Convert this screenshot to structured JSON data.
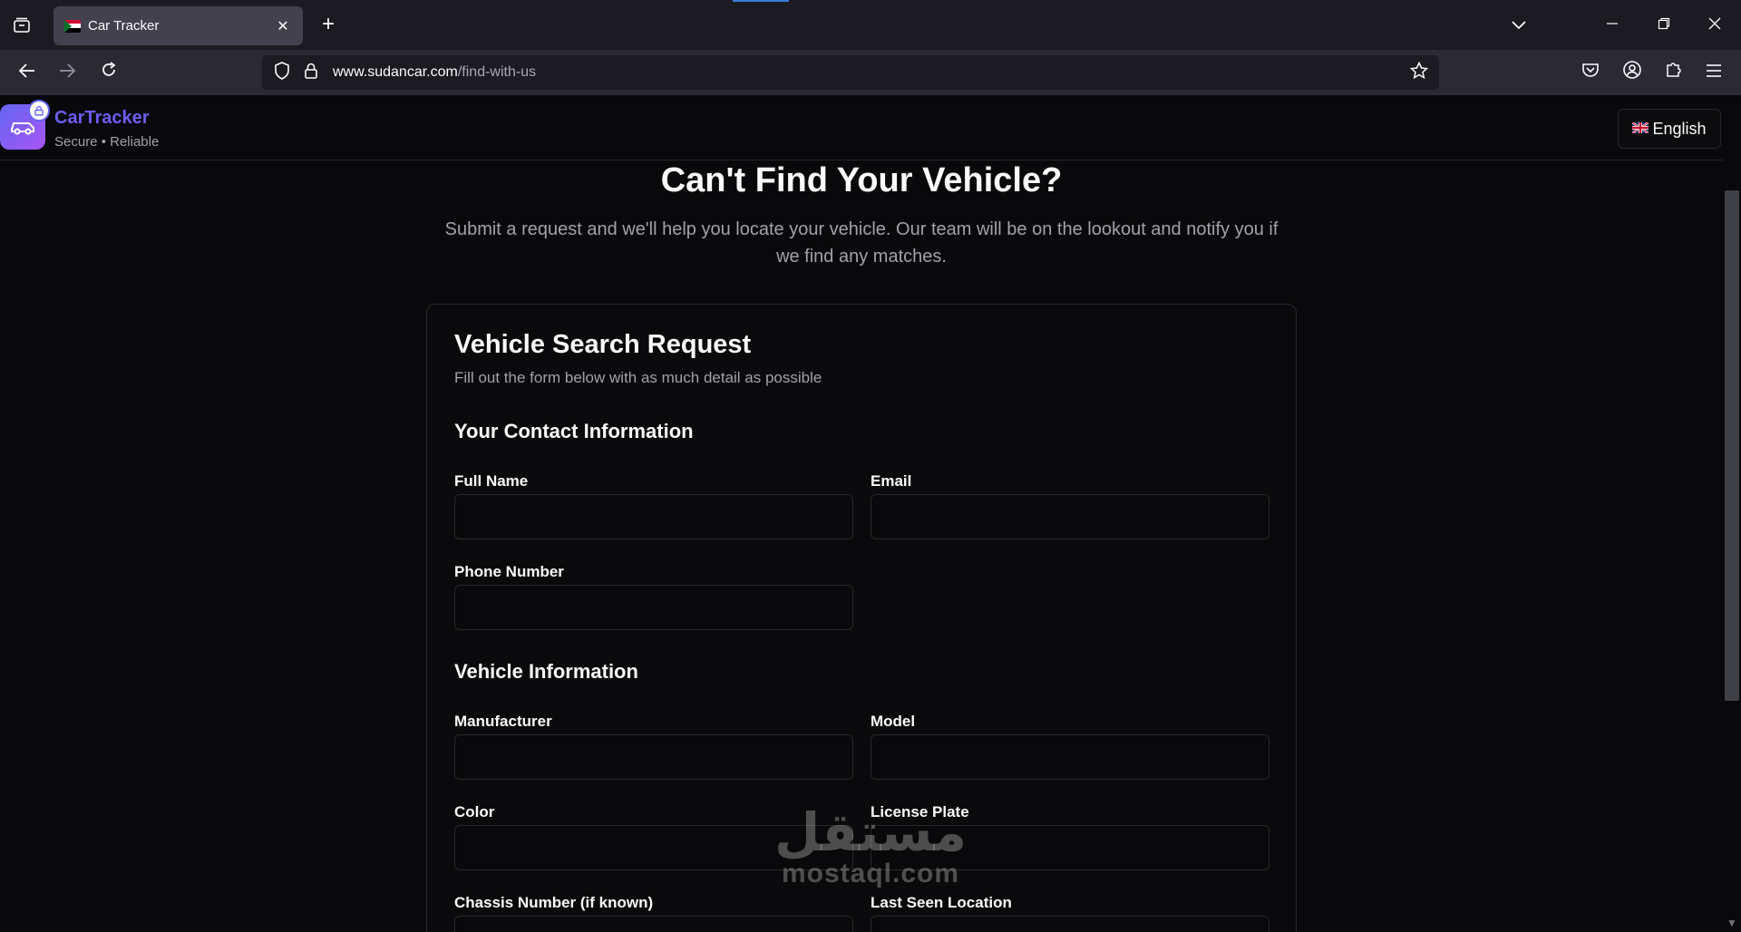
{
  "browser": {
    "tab_title": "Car Tracker",
    "url_host": "www.sudancar.com",
    "url_path": "/find-with-us",
    "icons": {
      "tab_list": "tab-list-icon",
      "close_tab": "close-icon",
      "new_tab": "plus-icon",
      "back": "arrow-left-icon",
      "forward": "arrow-right-icon",
      "reload": "reload-icon",
      "shield": "shield-icon",
      "lock": "lock-icon",
      "bookmark": "star-icon",
      "pocket": "pocket-icon",
      "account": "account-icon",
      "extensions": "puzzle-icon",
      "menu": "hamburger-icon"
    }
  },
  "header": {
    "brand_name": "CarTracker",
    "brand_tagline": "Secure • Reliable",
    "language_button": "English",
    "brand_color": "#6d5cf0"
  },
  "hero": {
    "title": "Can't Find Your Vehicle?",
    "subtitle": "Submit a request and we'll help you locate your vehicle. Our team will be on the lookout and notify you if we find any matches."
  },
  "form": {
    "title": "Vehicle Search Request",
    "description": "Fill out the form below with as much detail as possible",
    "contact_section": "Your Contact Information",
    "vehicle_section": "Vehicle Information",
    "fields": {
      "full_name": {
        "label": "Full Name",
        "value": ""
      },
      "email": {
        "label": "Email",
        "value": ""
      },
      "phone": {
        "label": "Phone Number",
        "value": ""
      },
      "manufacturer": {
        "label": "Manufacturer",
        "value": ""
      },
      "model": {
        "label": "Model",
        "value": ""
      },
      "color": {
        "label": "Color",
        "value": ""
      },
      "license_plate": {
        "label": "License Plate",
        "value": ""
      },
      "chassis": {
        "label": "Chassis Number (if known)",
        "value": ""
      },
      "last_seen": {
        "label": "Last Seen Location",
        "value": ""
      }
    }
  },
  "watermark": {
    "arabic": "مستقل",
    "latin": "mostaql.com"
  }
}
